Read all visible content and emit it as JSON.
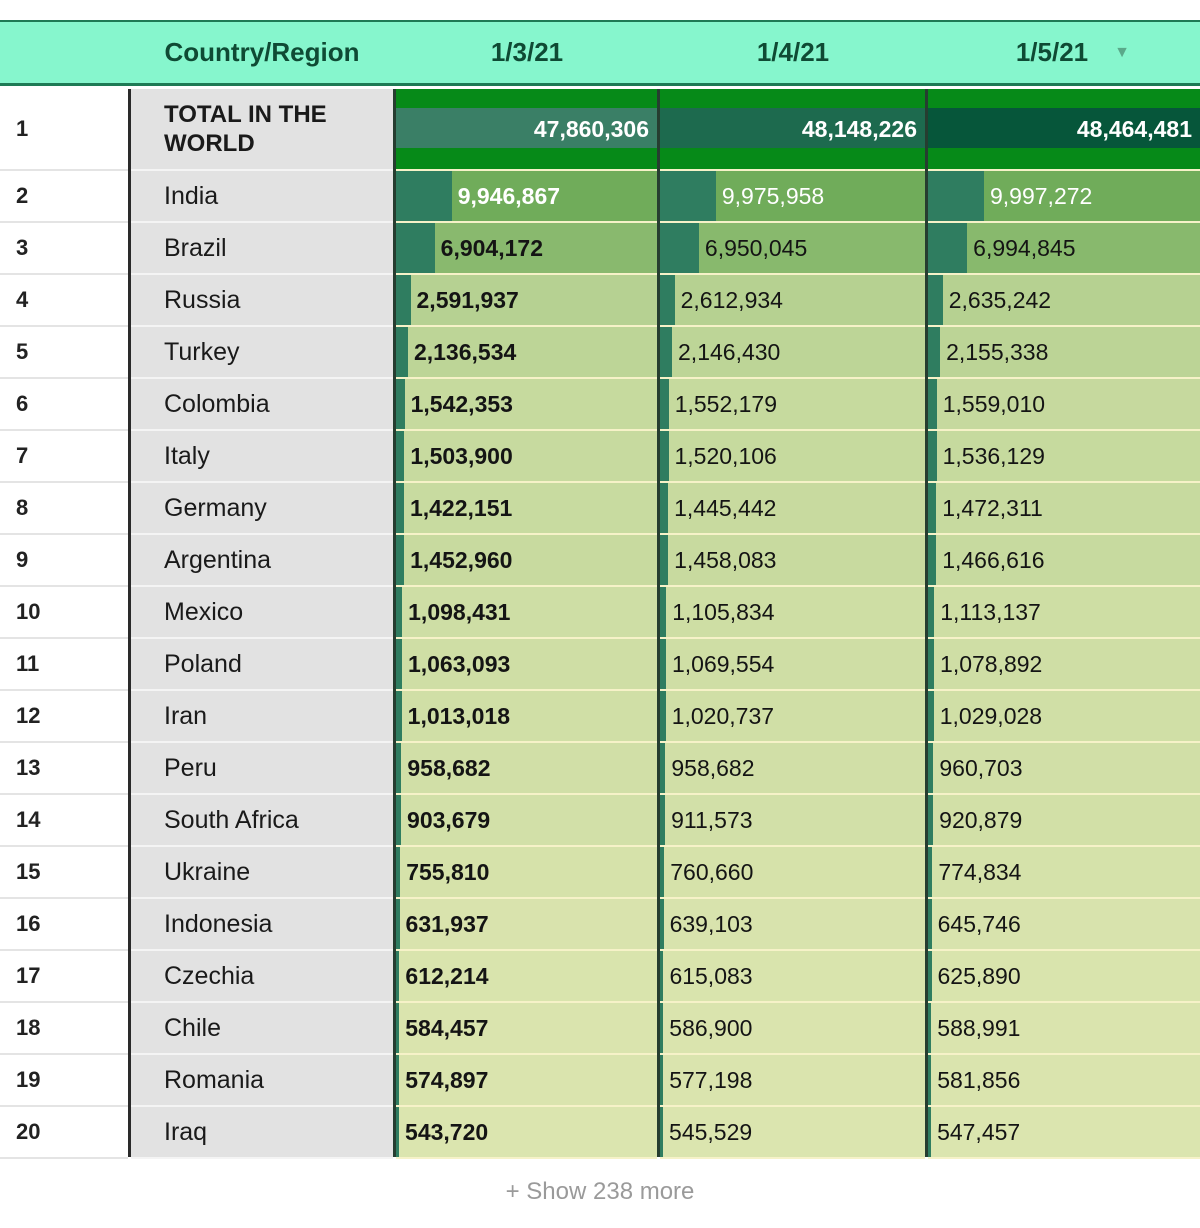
{
  "header": {
    "country_label": "Country/Region",
    "dates": [
      "1/3/21",
      "1/4/21",
      "1/5/21"
    ],
    "sort_icon": "triangle-down-icon"
  },
  "table": {
    "max_value": 48464481,
    "rows": [
      {
        "rank": "1",
        "country": "TOTAL IN THE WORLD",
        "values": [
          47860306,
          48148226,
          48464481
        ],
        "labels": [
          "47,860,306",
          "48,148,226",
          "48,464,481"
        ]
      },
      {
        "rank": "2",
        "country": "India",
        "values": [
          9946867,
          9975958,
          9997272
        ],
        "labels": [
          "9,946,867",
          "9,975,958",
          "9,997,272"
        ]
      },
      {
        "rank": "3",
        "country": "Brazil",
        "values": [
          6904172,
          6950045,
          6994845
        ],
        "labels": [
          "6,904,172",
          "6,950,045",
          "6,994,845"
        ]
      },
      {
        "rank": "4",
        "country": "Russia",
        "values": [
          2591937,
          2612934,
          2635242
        ],
        "labels": [
          "2,591,937",
          "2,612,934",
          "2,635,242"
        ]
      },
      {
        "rank": "5",
        "country": "Turkey",
        "values": [
          2136534,
          2146430,
          2155338
        ],
        "labels": [
          "2,136,534",
          "2,146,430",
          "2,155,338"
        ]
      },
      {
        "rank": "6",
        "country": "Colombia",
        "values": [
          1542353,
          1552179,
          1559010
        ],
        "labels": [
          "1,542,353",
          "1,552,179",
          "1,559,010"
        ]
      },
      {
        "rank": "7",
        "country": "Italy",
        "values": [
          1503900,
          1520106,
          1536129
        ],
        "labels": [
          "1,503,900",
          "1,520,106",
          "1,536,129"
        ]
      },
      {
        "rank": "8",
        "country": "Germany",
        "values": [
          1422151,
          1445442,
          1472311
        ],
        "labels": [
          "1,422,151",
          "1,445,442",
          "1,472,311"
        ]
      },
      {
        "rank": "9",
        "country": "Argentina",
        "values": [
          1452960,
          1458083,
          1466616
        ],
        "labels": [
          "1,452,960",
          "1,458,083",
          "1,466,616"
        ]
      },
      {
        "rank": "10",
        "country": "Mexico",
        "values": [
          1098431,
          1105834,
          1113137
        ],
        "labels": [
          "1,098,431",
          "1,105,834",
          "1,113,137"
        ]
      },
      {
        "rank": "11",
        "country": "Poland",
        "values": [
          1063093,
          1069554,
          1078892
        ],
        "labels": [
          "1,063,093",
          "1,069,554",
          "1,078,892"
        ]
      },
      {
        "rank": "12",
        "country": "Iran",
        "values": [
          1013018,
          1020737,
          1029028
        ],
        "labels": [
          "1,013,018",
          "1,020,737",
          "1,029,028"
        ]
      },
      {
        "rank": "13",
        "country": "Peru",
        "values": [
          958682,
          958682,
          960703
        ],
        "labels": [
          "958,682",
          "958,682",
          "960,703"
        ]
      },
      {
        "rank": "14",
        "country": "South Africa",
        "values": [
          903679,
          911573,
          920879
        ],
        "labels": [
          "903,679",
          "911,573",
          "920,879"
        ]
      },
      {
        "rank": "15",
        "country": "Ukraine",
        "values": [
          755810,
          760660,
          774834
        ],
        "labels": [
          "755,810",
          "760,660",
          "774,834"
        ]
      },
      {
        "rank": "16",
        "country": "Indonesia",
        "values": [
          631937,
          639103,
          645746
        ],
        "labels": [
          "631,937",
          "639,103",
          "645,746"
        ]
      },
      {
        "rank": "17",
        "country": "Czechia",
        "values": [
          612214,
          615083,
          625890
        ],
        "labels": [
          "612,214",
          "615,083",
          "625,890"
        ]
      },
      {
        "rank": "18",
        "country": "Chile",
        "values": [
          584457,
          586900,
          588991
        ],
        "labels": [
          "584,457",
          "586,900",
          "588,991"
        ]
      },
      {
        "rank": "19",
        "country": "Romania",
        "values": [
          574897,
          577198,
          581856
        ],
        "labels": [
          "574,897",
          "577,198",
          "581,856"
        ]
      },
      {
        "rank": "20",
        "country": "Iraq",
        "values": [
          543720,
          545529,
          547457
        ],
        "labels": [
          "543,720",
          "545,529",
          "547,457"
        ]
      }
    ]
  },
  "footer": {
    "show_more": "+ Show 238 more"
  },
  "colors": {
    "header_bg": "#86f6cd",
    "bar_dark": "#2f7d60",
    "total_band": [
      "#3a7f66",
      "#1d6a4e",
      "#06563a"
    ],
    "total_bg": "#068a18"
  }
}
